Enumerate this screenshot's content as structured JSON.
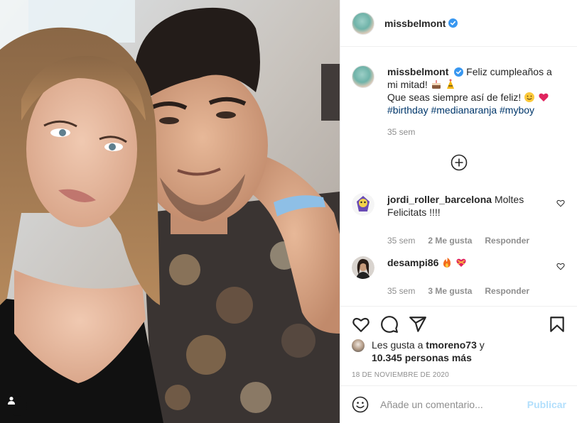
{
  "post": {
    "username": "missbelmont",
    "verified": true,
    "caption": {
      "line1": "Feliz cumpleaños a mi mitad!",
      "line1_emojis": [
        "cake-emoji",
        "party-hat-emoji"
      ],
      "line2": "Que seas siempre así de feliz!",
      "line2_emojis": [
        "smiling-face-emoji",
        "red-heart-emoji"
      ],
      "hashtags": [
        "#birthday",
        "#medianaranja",
        "#myboy"
      ],
      "time": "35 sem"
    }
  },
  "comments": [
    {
      "username": "jordi_roller_barcelona",
      "text": "Moltes Felicitats !!!!",
      "time": "35 sem",
      "likes": "2 Me gusta",
      "reply": "Responder"
    },
    {
      "username": "desampi86",
      "text": "",
      "emojis": [
        "fire-emoji",
        "heart-ribbon-emoji"
      ],
      "time": "35 sem",
      "likes": "3 Me gusta",
      "reply": "Responder"
    }
  ],
  "likes": {
    "prefix": "Les gusta a",
    "user": "tmoreno73",
    "connector": "y",
    "others": "10.345 personas más"
  },
  "date": "18 DE NOVIEMBRE DE 2020",
  "add_comment": {
    "placeholder": "Añade un comentario...",
    "publish": "Publicar"
  },
  "icons": {
    "like": "heart-icon",
    "comment": "comment-bubble-icon",
    "share": "paper-plane-icon",
    "save": "bookmark-icon",
    "emoji": "emoji-face-icon",
    "more": "plus-circle-icon",
    "tags": "user-tag-icon"
  },
  "colors": {
    "verified": "#3897f0",
    "hashtag": "#00376b",
    "muted": "#8e8e8e",
    "publish_disabled": "#b2dffc"
  }
}
